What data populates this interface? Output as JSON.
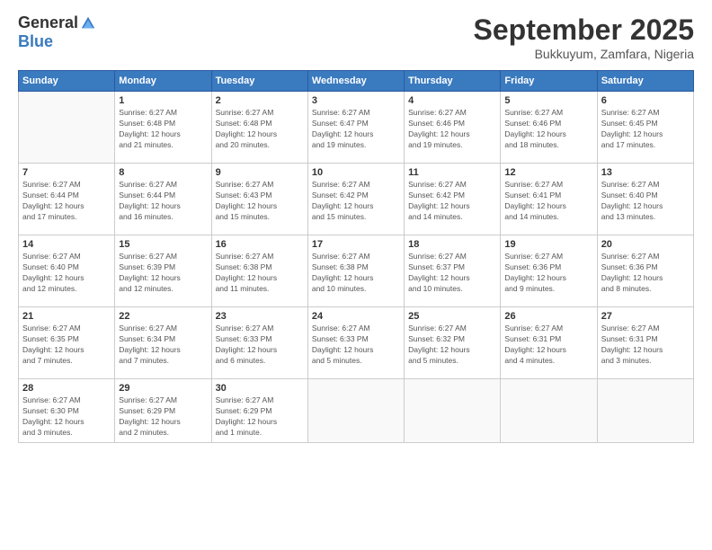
{
  "header": {
    "logo_general": "General",
    "logo_blue": "Blue",
    "month_title": "September 2025",
    "subtitle": "Bukkuyum, Zamfara, Nigeria"
  },
  "calendar": {
    "days_of_week": [
      "Sunday",
      "Monday",
      "Tuesday",
      "Wednesday",
      "Thursday",
      "Friday",
      "Saturday"
    ],
    "weeks": [
      [
        {
          "day": "",
          "info": ""
        },
        {
          "day": "1",
          "info": "Sunrise: 6:27 AM\nSunset: 6:48 PM\nDaylight: 12 hours\nand 21 minutes."
        },
        {
          "day": "2",
          "info": "Sunrise: 6:27 AM\nSunset: 6:48 PM\nDaylight: 12 hours\nand 20 minutes."
        },
        {
          "day": "3",
          "info": "Sunrise: 6:27 AM\nSunset: 6:47 PM\nDaylight: 12 hours\nand 19 minutes."
        },
        {
          "day": "4",
          "info": "Sunrise: 6:27 AM\nSunset: 6:46 PM\nDaylight: 12 hours\nand 19 minutes."
        },
        {
          "day": "5",
          "info": "Sunrise: 6:27 AM\nSunset: 6:46 PM\nDaylight: 12 hours\nand 18 minutes."
        },
        {
          "day": "6",
          "info": "Sunrise: 6:27 AM\nSunset: 6:45 PM\nDaylight: 12 hours\nand 17 minutes."
        }
      ],
      [
        {
          "day": "7",
          "info": "Sunrise: 6:27 AM\nSunset: 6:44 PM\nDaylight: 12 hours\nand 17 minutes."
        },
        {
          "day": "8",
          "info": "Sunrise: 6:27 AM\nSunset: 6:44 PM\nDaylight: 12 hours\nand 16 minutes."
        },
        {
          "day": "9",
          "info": "Sunrise: 6:27 AM\nSunset: 6:43 PM\nDaylight: 12 hours\nand 15 minutes."
        },
        {
          "day": "10",
          "info": "Sunrise: 6:27 AM\nSunset: 6:42 PM\nDaylight: 12 hours\nand 15 minutes."
        },
        {
          "day": "11",
          "info": "Sunrise: 6:27 AM\nSunset: 6:42 PM\nDaylight: 12 hours\nand 14 minutes."
        },
        {
          "day": "12",
          "info": "Sunrise: 6:27 AM\nSunset: 6:41 PM\nDaylight: 12 hours\nand 14 minutes."
        },
        {
          "day": "13",
          "info": "Sunrise: 6:27 AM\nSunset: 6:40 PM\nDaylight: 12 hours\nand 13 minutes."
        }
      ],
      [
        {
          "day": "14",
          "info": "Sunrise: 6:27 AM\nSunset: 6:40 PM\nDaylight: 12 hours\nand 12 minutes."
        },
        {
          "day": "15",
          "info": "Sunrise: 6:27 AM\nSunset: 6:39 PM\nDaylight: 12 hours\nand 12 minutes."
        },
        {
          "day": "16",
          "info": "Sunrise: 6:27 AM\nSunset: 6:38 PM\nDaylight: 12 hours\nand 11 minutes."
        },
        {
          "day": "17",
          "info": "Sunrise: 6:27 AM\nSunset: 6:38 PM\nDaylight: 12 hours\nand 10 minutes."
        },
        {
          "day": "18",
          "info": "Sunrise: 6:27 AM\nSunset: 6:37 PM\nDaylight: 12 hours\nand 10 minutes."
        },
        {
          "day": "19",
          "info": "Sunrise: 6:27 AM\nSunset: 6:36 PM\nDaylight: 12 hours\nand 9 minutes."
        },
        {
          "day": "20",
          "info": "Sunrise: 6:27 AM\nSunset: 6:36 PM\nDaylight: 12 hours\nand 8 minutes."
        }
      ],
      [
        {
          "day": "21",
          "info": "Sunrise: 6:27 AM\nSunset: 6:35 PM\nDaylight: 12 hours\nand 7 minutes."
        },
        {
          "day": "22",
          "info": "Sunrise: 6:27 AM\nSunset: 6:34 PM\nDaylight: 12 hours\nand 7 minutes."
        },
        {
          "day": "23",
          "info": "Sunrise: 6:27 AM\nSunset: 6:33 PM\nDaylight: 12 hours\nand 6 minutes."
        },
        {
          "day": "24",
          "info": "Sunrise: 6:27 AM\nSunset: 6:33 PM\nDaylight: 12 hours\nand 5 minutes."
        },
        {
          "day": "25",
          "info": "Sunrise: 6:27 AM\nSunset: 6:32 PM\nDaylight: 12 hours\nand 5 minutes."
        },
        {
          "day": "26",
          "info": "Sunrise: 6:27 AM\nSunset: 6:31 PM\nDaylight: 12 hours\nand 4 minutes."
        },
        {
          "day": "27",
          "info": "Sunrise: 6:27 AM\nSunset: 6:31 PM\nDaylight: 12 hours\nand 3 minutes."
        }
      ],
      [
        {
          "day": "28",
          "info": "Sunrise: 6:27 AM\nSunset: 6:30 PM\nDaylight: 12 hours\nand 3 minutes."
        },
        {
          "day": "29",
          "info": "Sunrise: 6:27 AM\nSunset: 6:29 PM\nDaylight: 12 hours\nand 2 minutes."
        },
        {
          "day": "30",
          "info": "Sunrise: 6:27 AM\nSunset: 6:29 PM\nDaylight: 12 hours\nand 1 minute."
        },
        {
          "day": "",
          "info": ""
        },
        {
          "day": "",
          "info": ""
        },
        {
          "day": "",
          "info": ""
        },
        {
          "day": "",
          "info": ""
        }
      ]
    ]
  }
}
